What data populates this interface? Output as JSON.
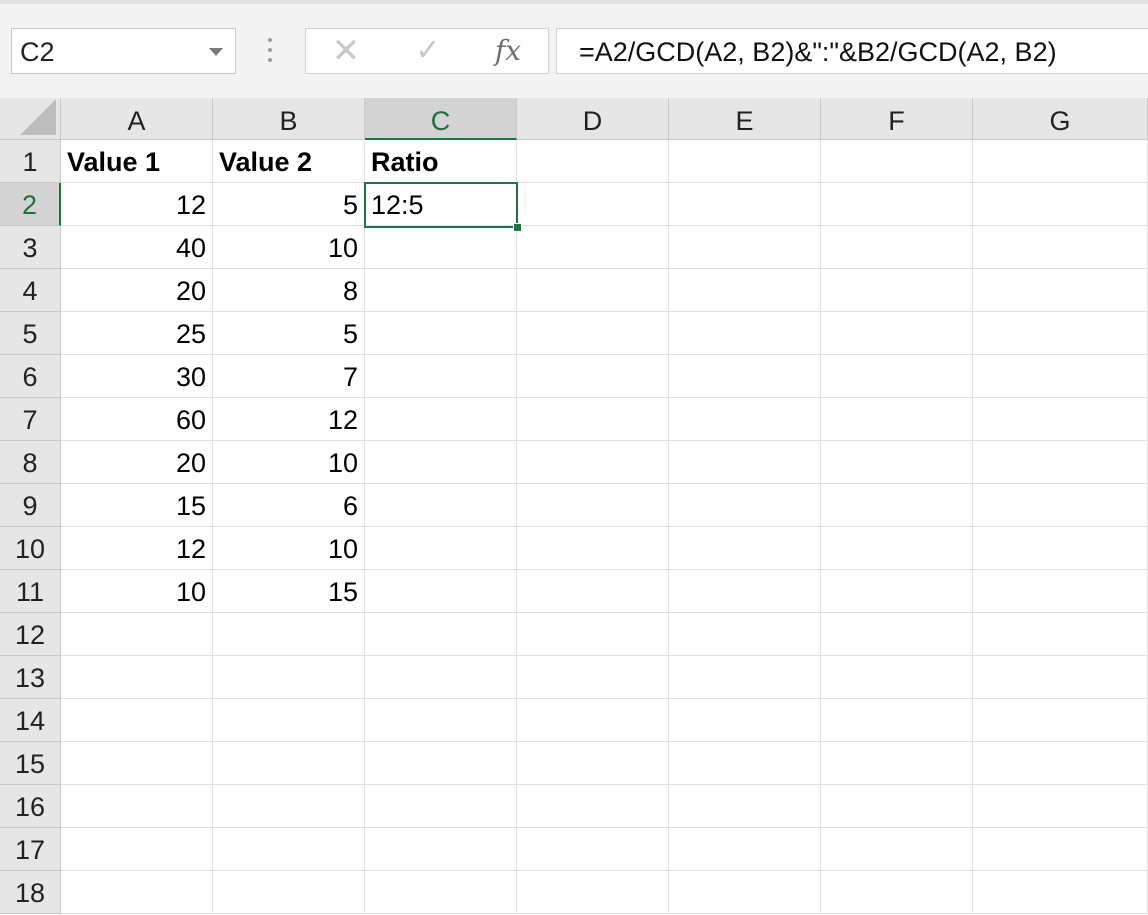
{
  "name_box": {
    "value": "C2"
  },
  "formula_bar": {
    "cancel_label": "✕",
    "enter_label": "✓",
    "fx_label": "fx",
    "formula": "=A2/GCD(A2, B2)&\":\"&B2/GCD(A2, B2)"
  },
  "columns": [
    "A",
    "B",
    "C",
    "D",
    "E",
    "F",
    "G"
  ],
  "rows": [
    "1",
    "2",
    "3",
    "4",
    "5",
    "6",
    "7",
    "8",
    "9",
    "10",
    "11",
    "12",
    "13",
    "14",
    "15",
    "16",
    "17",
    "18"
  ],
  "active_cell": {
    "column": "C",
    "row": "2"
  },
  "cells": {
    "A1": "Value 1",
    "B1": "Value 2",
    "C1": "Ratio",
    "A2": "12",
    "B2": "5",
    "C2": "12:5",
    "A3": "40",
    "B3": "10",
    "A4": "20",
    "B4": "8",
    "A5": "25",
    "B5": "5",
    "A6": "30",
    "B6": "7",
    "A7": "60",
    "B7": "12",
    "A8": "20",
    "B8": "10",
    "A9": "15",
    "B9": "6",
    "A10": "12",
    "B10": "10",
    "A11": "10",
    "B11": "15"
  },
  "colors": {
    "accent": "#217346",
    "header_bg": "#e6e6e6",
    "header_active_bg": "#d3d3d3",
    "gridline": "#e1e1e1"
  }
}
